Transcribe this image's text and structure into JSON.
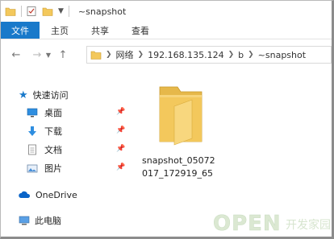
{
  "window": {
    "title": "~snapshot"
  },
  "ribbon": {
    "tabs": [
      "文件",
      "主页",
      "共享",
      "查看"
    ]
  },
  "address": {
    "segments": [
      "网络",
      "192.168.135.124",
      "b",
      "~snapshot"
    ]
  },
  "nav": {
    "quick_access": "快速访问",
    "items": [
      {
        "label": "桌面",
        "icon": "desktop-icon"
      },
      {
        "label": "下载",
        "icon": "download-icon"
      },
      {
        "label": "文档",
        "icon": "document-icon"
      },
      {
        "label": "图片",
        "icon": "picture-icon"
      }
    ],
    "onedrive": "OneDrive",
    "this_pc": "此电脑"
  },
  "content": {
    "folder_name_line1": "snapshot_05072",
    "folder_name_line2": "017_172919_65"
  },
  "watermark": {
    "text_latin": "OPEN",
    "text_cn": "开发家园"
  },
  "colors": {
    "file_tab": "#1979ca",
    "folder": "#f3c85c",
    "onedrive": "#0a64c8"
  }
}
